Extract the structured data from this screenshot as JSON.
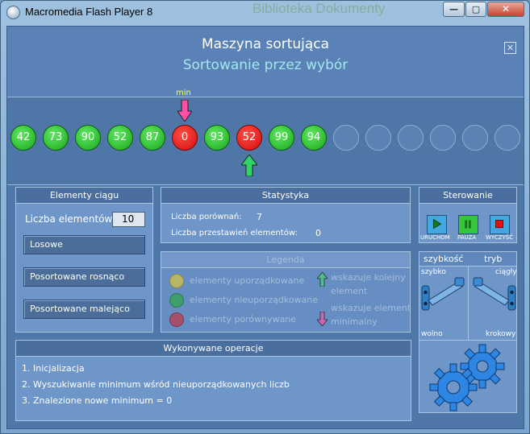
{
  "window": {
    "title": "Macromedia Flash Player 8",
    "ghost_title": "Biblioteka Dokumenty",
    "minimize_label": "—",
    "maximize_label": "▢",
    "close_label": "✕"
  },
  "header": {
    "title": "Maszyna sortująca",
    "subtitle": "Sortowanie przez wybór",
    "close_label": "✕"
  },
  "sorting": {
    "min_label": "min",
    "min_index": 5,
    "current_index": 7,
    "balls": [
      {
        "value": "42",
        "state": "green"
      },
      {
        "value": "73",
        "state": "green"
      },
      {
        "value": "90",
        "state": "green"
      },
      {
        "value": "52",
        "state": "green"
      },
      {
        "value": "87",
        "state": "green"
      },
      {
        "value": "0",
        "state": "red"
      },
      {
        "value": "93",
        "state": "green"
      },
      {
        "value": "52",
        "state": "red"
      },
      {
        "value": "99",
        "state": "green"
      },
      {
        "value": "94",
        "state": "green"
      },
      {
        "value": "",
        "state": "empty"
      },
      {
        "value": "",
        "state": "empty"
      },
      {
        "value": "",
        "state": "empty"
      },
      {
        "value": "",
        "state": "empty"
      },
      {
        "value": "",
        "state": "empty"
      },
      {
        "value": "",
        "state": "empty"
      }
    ],
    "colors": {
      "green": "#22b324",
      "red": "#e0140f",
      "pink_arrow": "#ff4fa8",
      "green_arrow": "#2fd36a"
    }
  },
  "elements_panel": {
    "title": "Elementy ciągu",
    "count_label": "Liczba elementów",
    "count_value": "10",
    "btn_random": "Losowe",
    "btn_sorted_asc": "Posortowane rosnąco",
    "btn_sorted_desc": "Posortowane malejąco"
  },
  "stats_panel": {
    "title": "Statystyka",
    "comparisons_label": "Liczba porównań:",
    "comparisons_value": "7",
    "swaps_label": "Liczba przestawień elementów:",
    "swaps_value": "0"
  },
  "legend_panel": {
    "title": "Legenda",
    "ordered": "elementy uporządkowane",
    "unordered": "elementy nieuporządkowane",
    "compared": "elementy porównywane",
    "next_line1": "wskazuje kolejny",
    "next_line2": "element",
    "min_line1": "wskazuje element",
    "min_line2": "minimalny"
  },
  "control_panel": {
    "title": "Sterowanie",
    "run": "URUCHOM",
    "pause": "PAUZA",
    "clear": "WYCZYŚĆ",
    "speed_title": "szybkość",
    "mode_title": "tryb",
    "speed_fast": "szybko",
    "speed_slow": "wolno",
    "mode_continuous": "ciągły",
    "mode_step": "krokowy"
  },
  "operations_panel": {
    "title": "Wykonywane operacje",
    "items": [
      "1. Inicjalizacja",
      "2. Wyszukiwanie minimum wśród nieuporządkowanych liczb",
      "3. Znalezione nowe minimum = 0"
    ]
  }
}
